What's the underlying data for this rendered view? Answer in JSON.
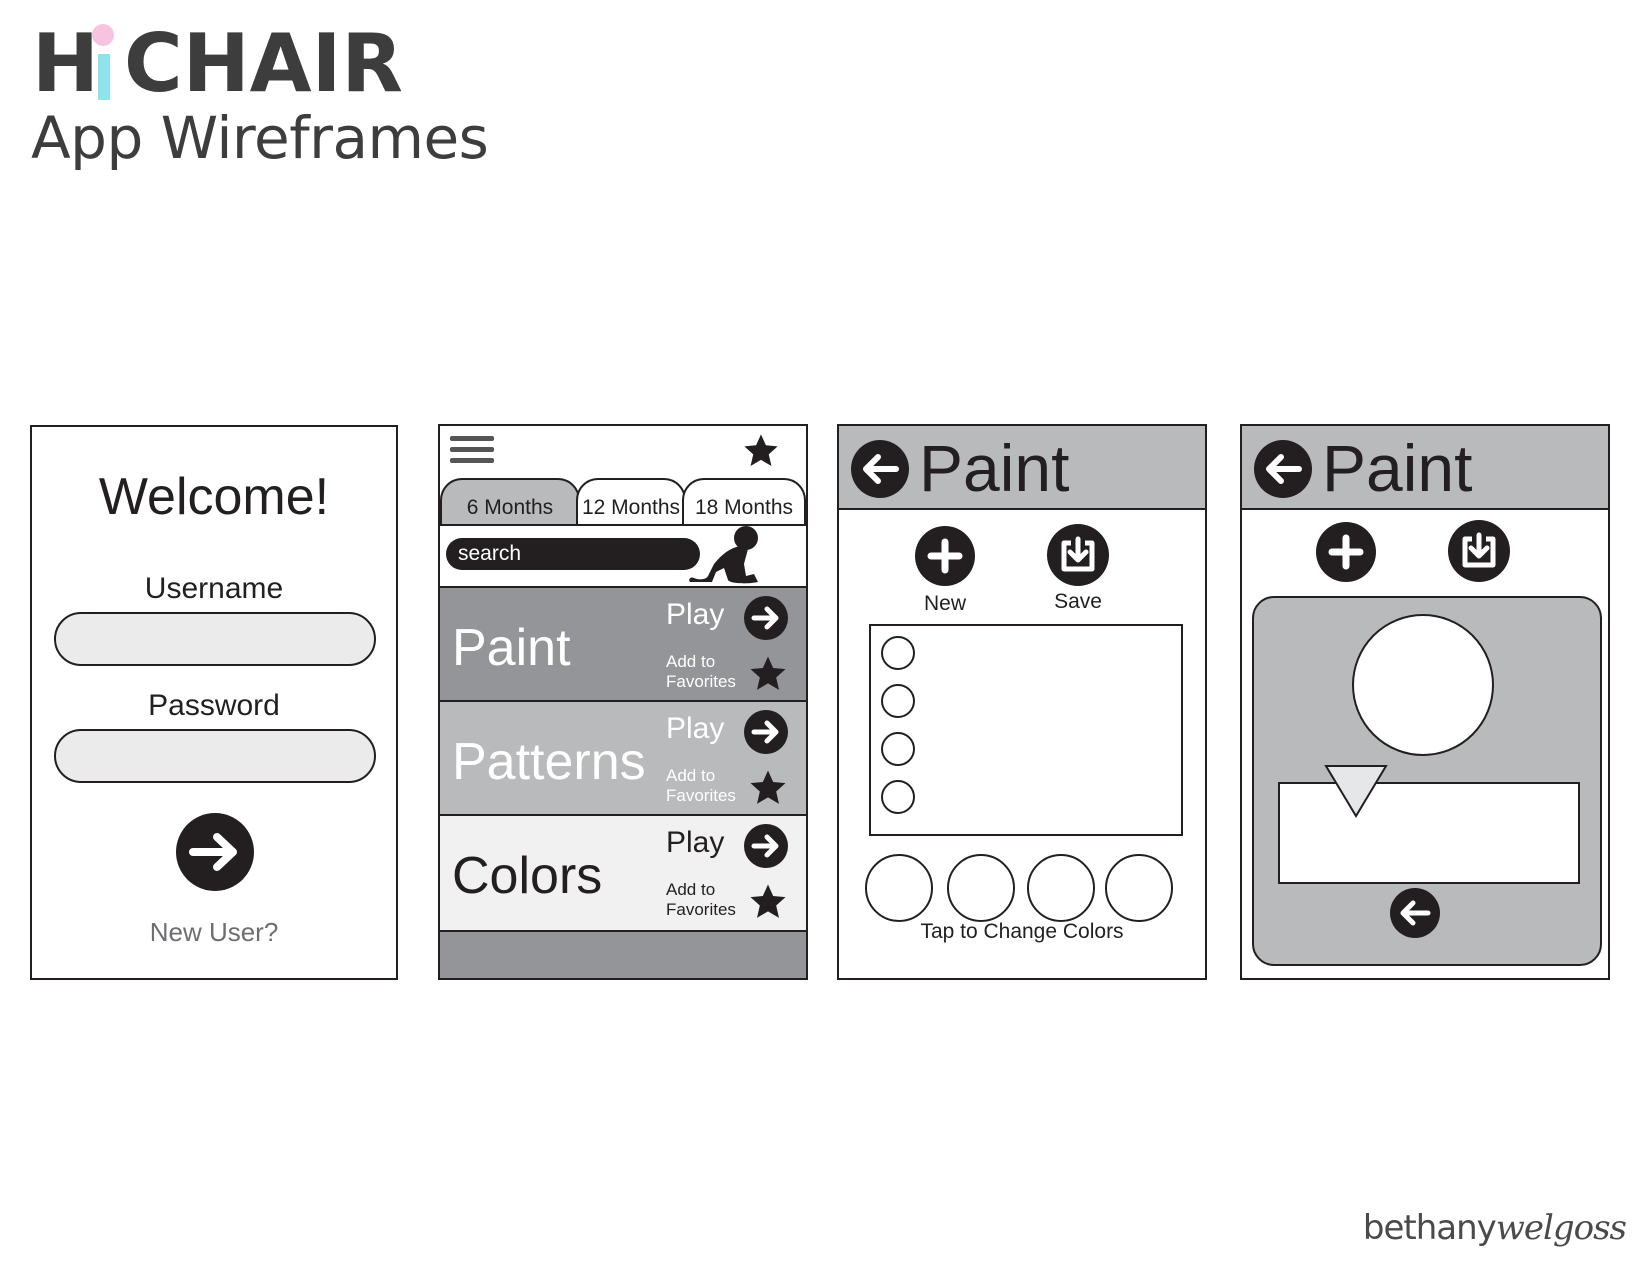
{
  "header": {
    "logo_h": "H",
    "logo_chair": "CHAIR",
    "subtitle": "App Wireframes",
    "credit_a": "bethany",
    "credit_b": "welgoss"
  },
  "colors": {
    "dark": "#231f20",
    "gray_panel": "#b9babc",
    "gray_dark": "#939598",
    "gray_light": "#f1f1f2",
    "input_fill": "#ebebeb",
    "logo_dot": "#f7c3e1",
    "logo_stem": "#8fe3ea"
  },
  "login": {
    "title": "Welcome!",
    "username_label": "Username",
    "password_label": "Password",
    "submit_icon": "arrow-right-icon",
    "new_user": "New User?"
  },
  "browse": {
    "menu_icon": "hamburger-icon",
    "favorites_icon": "star-icon",
    "tabs": [
      "6 Months",
      "12 Months",
      "18 Months"
    ],
    "search_placeholder": "search",
    "mascot_icon": "crawling-baby-icon",
    "rows": [
      {
        "title": "Paint",
        "play": "Play",
        "fav": "Add to\nFavorites"
      },
      {
        "title": "Patterns",
        "play": "Play",
        "fav": "Add to\nFavorites"
      },
      {
        "title": "Colors",
        "play": "Play",
        "fav": "Add to\nFavorites"
      }
    ]
  },
  "paint_menu": {
    "title": "Paint",
    "back_icon": "arrow-left-icon",
    "new_label": "New",
    "save_label": "Save",
    "new_icon": "plus-icon",
    "save_icon": "download-icon",
    "footer": "Tap to Change Colors"
  },
  "paint_canvas": {
    "title": "Paint",
    "back_icon": "arrow-left-icon",
    "new_icon": "plus-icon",
    "save_icon": "download-icon",
    "bottom_icon": "arrow-left-icon"
  }
}
